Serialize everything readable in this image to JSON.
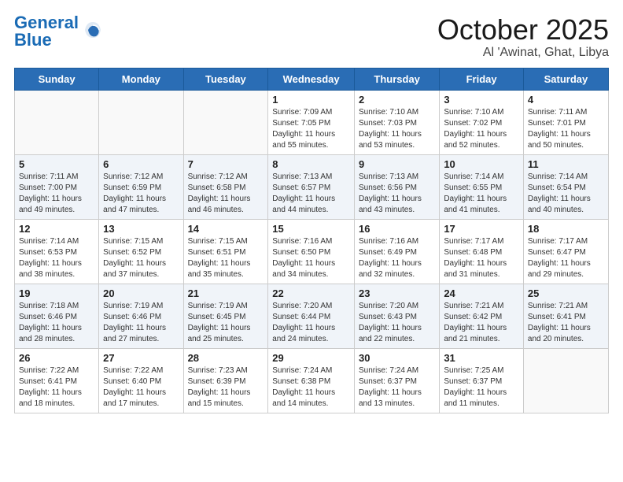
{
  "header": {
    "logo_line1": "General",
    "logo_line2": "Blue",
    "month": "October 2025",
    "location": "Al 'Awinat, Ghat, Libya"
  },
  "days_of_week": [
    "Sunday",
    "Monday",
    "Tuesday",
    "Wednesday",
    "Thursday",
    "Friday",
    "Saturday"
  ],
  "weeks": [
    [
      {
        "day": "",
        "info": ""
      },
      {
        "day": "",
        "info": ""
      },
      {
        "day": "",
        "info": ""
      },
      {
        "day": "1",
        "info": "Sunrise: 7:09 AM\nSunset: 7:05 PM\nDaylight: 11 hours\nand 55 minutes."
      },
      {
        "day": "2",
        "info": "Sunrise: 7:10 AM\nSunset: 7:03 PM\nDaylight: 11 hours\nand 53 minutes."
      },
      {
        "day": "3",
        "info": "Sunrise: 7:10 AM\nSunset: 7:02 PM\nDaylight: 11 hours\nand 52 minutes."
      },
      {
        "day": "4",
        "info": "Sunrise: 7:11 AM\nSunset: 7:01 PM\nDaylight: 11 hours\nand 50 minutes."
      }
    ],
    [
      {
        "day": "5",
        "info": "Sunrise: 7:11 AM\nSunset: 7:00 PM\nDaylight: 11 hours\nand 49 minutes."
      },
      {
        "day": "6",
        "info": "Sunrise: 7:12 AM\nSunset: 6:59 PM\nDaylight: 11 hours\nand 47 minutes."
      },
      {
        "day": "7",
        "info": "Sunrise: 7:12 AM\nSunset: 6:58 PM\nDaylight: 11 hours\nand 46 minutes."
      },
      {
        "day": "8",
        "info": "Sunrise: 7:13 AM\nSunset: 6:57 PM\nDaylight: 11 hours\nand 44 minutes."
      },
      {
        "day": "9",
        "info": "Sunrise: 7:13 AM\nSunset: 6:56 PM\nDaylight: 11 hours\nand 43 minutes."
      },
      {
        "day": "10",
        "info": "Sunrise: 7:14 AM\nSunset: 6:55 PM\nDaylight: 11 hours\nand 41 minutes."
      },
      {
        "day": "11",
        "info": "Sunrise: 7:14 AM\nSunset: 6:54 PM\nDaylight: 11 hours\nand 40 minutes."
      }
    ],
    [
      {
        "day": "12",
        "info": "Sunrise: 7:14 AM\nSunset: 6:53 PM\nDaylight: 11 hours\nand 38 minutes."
      },
      {
        "day": "13",
        "info": "Sunrise: 7:15 AM\nSunset: 6:52 PM\nDaylight: 11 hours\nand 37 minutes."
      },
      {
        "day": "14",
        "info": "Sunrise: 7:15 AM\nSunset: 6:51 PM\nDaylight: 11 hours\nand 35 minutes."
      },
      {
        "day": "15",
        "info": "Sunrise: 7:16 AM\nSunset: 6:50 PM\nDaylight: 11 hours\nand 34 minutes."
      },
      {
        "day": "16",
        "info": "Sunrise: 7:16 AM\nSunset: 6:49 PM\nDaylight: 11 hours\nand 32 minutes."
      },
      {
        "day": "17",
        "info": "Sunrise: 7:17 AM\nSunset: 6:48 PM\nDaylight: 11 hours\nand 31 minutes."
      },
      {
        "day": "18",
        "info": "Sunrise: 7:17 AM\nSunset: 6:47 PM\nDaylight: 11 hours\nand 29 minutes."
      }
    ],
    [
      {
        "day": "19",
        "info": "Sunrise: 7:18 AM\nSunset: 6:46 PM\nDaylight: 11 hours\nand 28 minutes."
      },
      {
        "day": "20",
        "info": "Sunrise: 7:19 AM\nSunset: 6:46 PM\nDaylight: 11 hours\nand 27 minutes."
      },
      {
        "day": "21",
        "info": "Sunrise: 7:19 AM\nSunset: 6:45 PM\nDaylight: 11 hours\nand 25 minutes."
      },
      {
        "day": "22",
        "info": "Sunrise: 7:20 AM\nSunset: 6:44 PM\nDaylight: 11 hours\nand 24 minutes."
      },
      {
        "day": "23",
        "info": "Sunrise: 7:20 AM\nSunset: 6:43 PM\nDaylight: 11 hours\nand 22 minutes."
      },
      {
        "day": "24",
        "info": "Sunrise: 7:21 AM\nSunset: 6:42 PM\nDaylight: 11 hours\nand 21 minutes."
      },
      {
        "day": "25",
        "info": "Sunrise: 7:21 AM\nSunset: 6:41 PM\nDaylight: 11 hours\nand 20 minutes."
      }
    ],
    [
      {
        "day": "26",
        "info": "Sunrise: 7:22 AM\nSunset: 6:41 PM\nDaylight: 11 hours\nand 18 minutes."
      },
      {
        "day": "27",
        "info": "Sunrise: 7:22 AM\nSunset: 6:40 PM\nDaylight: 11 hours\nand 17 minutes."
      },
      {
        "day": "28",
        "info": "Sunrise: 7:23 AM\nSunset: 6:39 PM\nDaylight: 11 hours\nand 15 minutes."
      },
      {
        "day": "29",
        "info": "Sunrise: 7:24 AM\nSunset: 6:38 PM\nDaylight: 11 hours\nand 14 minutes."
      },
      {
        "day": "30",
        "info": "Sunrise: 7:24 AM\nSunset: 6:37 PM\nDaylight: 11 hours\nand 13 minutes."
      },
      {
        "day": "31",
        "info": "Sunrise: 7:25 AM\nSunset: 6:37 PM\nDaylight: 11 hours\nand 11 minutes."
      },
      {
        "day": "",
        "info": ""
      }
    ]
  ]
}
